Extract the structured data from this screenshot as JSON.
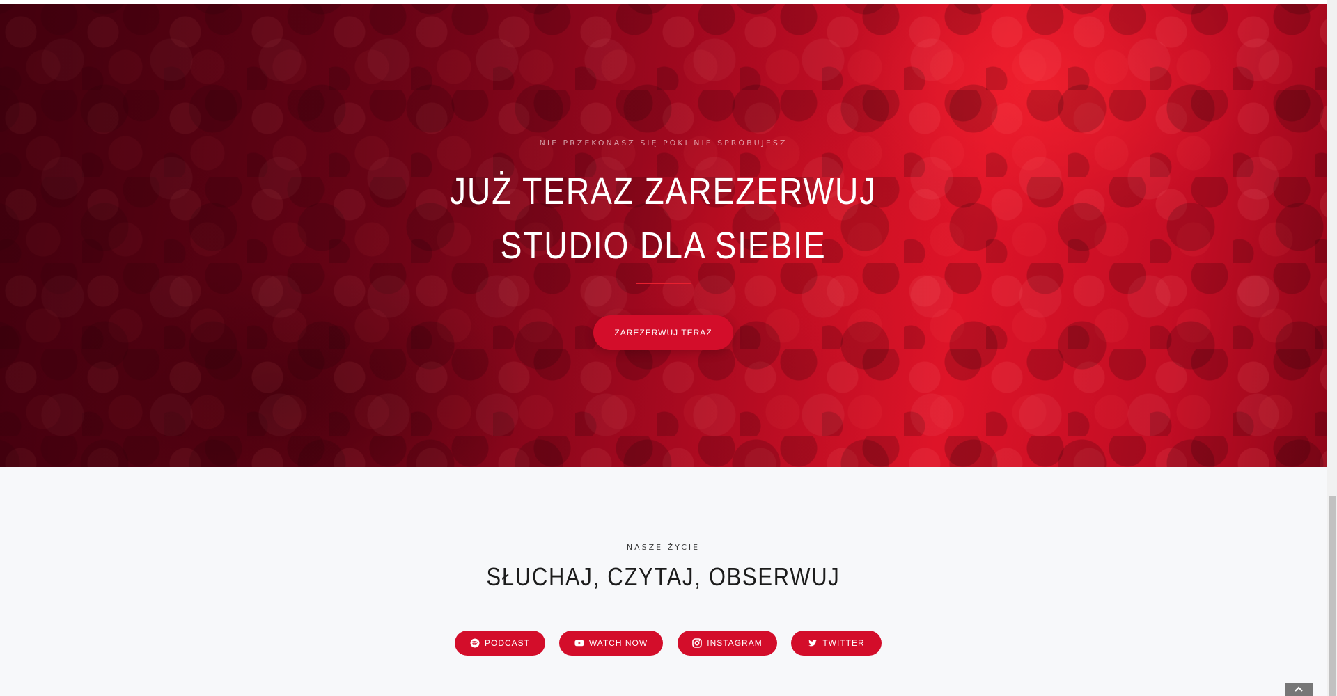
{
  "hero": {
    "eyebrow": "NIE PRZEKONASZ SIĘ PÓKI NIE SPRÓBUJESZ",
    "title_line1": "JUŻ TERAZ ZAREZERWUJ",
    "title_line2": "STUDIO DLA SIEBIE",
    "cta_label": "ZAREZERWUJ TERAZ",
    "background_image": "crowd-concert-photo-red-tint"
  },
  "section": {
    "eyebrow": "NASZE ŻYCIE",
    "title": "SŁUCHAJ, CZYTAJ, OBSERWUJ",
    "buttons": [
      {
        "label": "PODCAST",
        "icon": "spotify-icon"
      },
      {
        "label": "WATCH NOW",
        "icon": "youtube-icon"
      },
      {
        "label": "INSTAGRAM",
        "icon": "instagram-icon"
      },
      {
        "label": "TWITTER",
        "icon": "twitter-icon"
      }
    ]
  },
  "colors": {
    "accent": "#d30d2a",
    "hero_red": "#de1428",
    "section_bg": "#f7f8fa",
    "heading_text": "#1c1c1c"
  },
  "scroll_to_top_icon": "chevron-up-icon"
}
